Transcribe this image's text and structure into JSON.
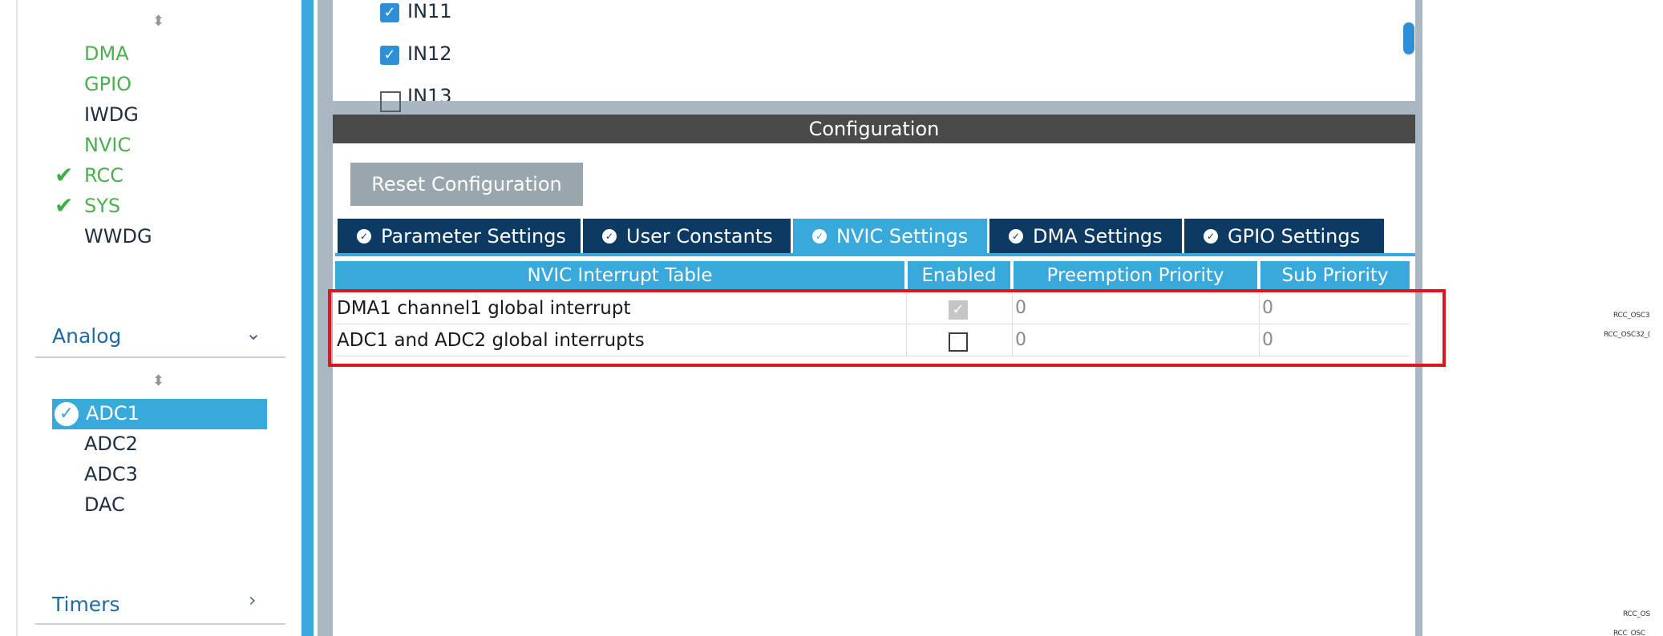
{
  "left_panel": {
    "system_core_items": [
      {
        "label": "DMA",
        "color": "green",
        "checked": false
      },
      {
        "label": "GPIO",
        "color": "green",
        "checked": false
      },
      {
        "label": "IWDG",
        "color": "default",
        "checked": false
      },
      {
        "label": "NVIC",
        "color": "green",
        "checked": false
      },
      {
        "label": "RCC",
        "color": "green",
        "checked": true
      },
      {
        "label": "SYS",
        "color": "green",
        "checked": true
      },
      {
        "label": "WWDG",
        "color": "default",
        "checked": false
      }
    ],
    "analog_section": {
      "title": "Analog",
      "expanded": true
    },
    "analog_items": [
      {
        "label": "ADC1",
        "selected": true,
        "checked": true
      },
      {
        "label": "ADC2",
        "selected": false
      },
      {
        "label": "ADC3",
        "selected": false
      },
      {
        "label": "DAC",
        "selected": false
      }
    ],
    "timers_section": {
      "title": "Timers",
      "expanded": false
    }
  },
  "channel_list": {
    "items": [
      {
        "label": "IN11",
        "checked": true
      },
      {
        "label": "IN12",
        "checked": true
      },
      {
        "label": "IN13",
        "checked": false
      }
    ]
  },
  "configuration": {
    "header": "Configuration",
    "reset_button": "Reset Configuration",
    "tabs": [
      {
        "label": "Parameter Settings",
        "active": false
      },
      {
        "label": "User Constants",
        "active": false
      },
      {
        "label": "NVIC Settings",
        "active": true
      },
      {
        "label": "DMA Settings",
        "active": false
      },
      {
        "label": "GPIO Settings",
        "active": false
      }
    ],
    "table": {
      "columns": [
        "NVIC Interrupt Table",
        "Enabled",
        "Preemption Priority",
        "Sub Priority"
      ],
      "rows": [
        {
          "name": "DMA1 channel1 global interrupt",
          "enabled": true,
          "enabled_state": "checked-disabled",
          "preemption": "0",
          "sub": "0"
        },
        {
          "name": "ADC1 and ADC2 global interrupts",
          "enabled": false,
          "enabled_state": "unchecked",
          "preemption": "0",
          "sub": "0"
        }
      ]
    }
  },
  "right_edge_labels": [
    "RCC_OSC3",
    "RCC_OSC32_(",
    "RCC_OS",
    "RCC_OSC_"
  ],
  "colors": {
    "accent_blue": "#39a9dc",
    "tab_dark": "#0d3a62",
    "highlight_red": "#e0141b",
    "green_check": "#3cb043"
  }
}
